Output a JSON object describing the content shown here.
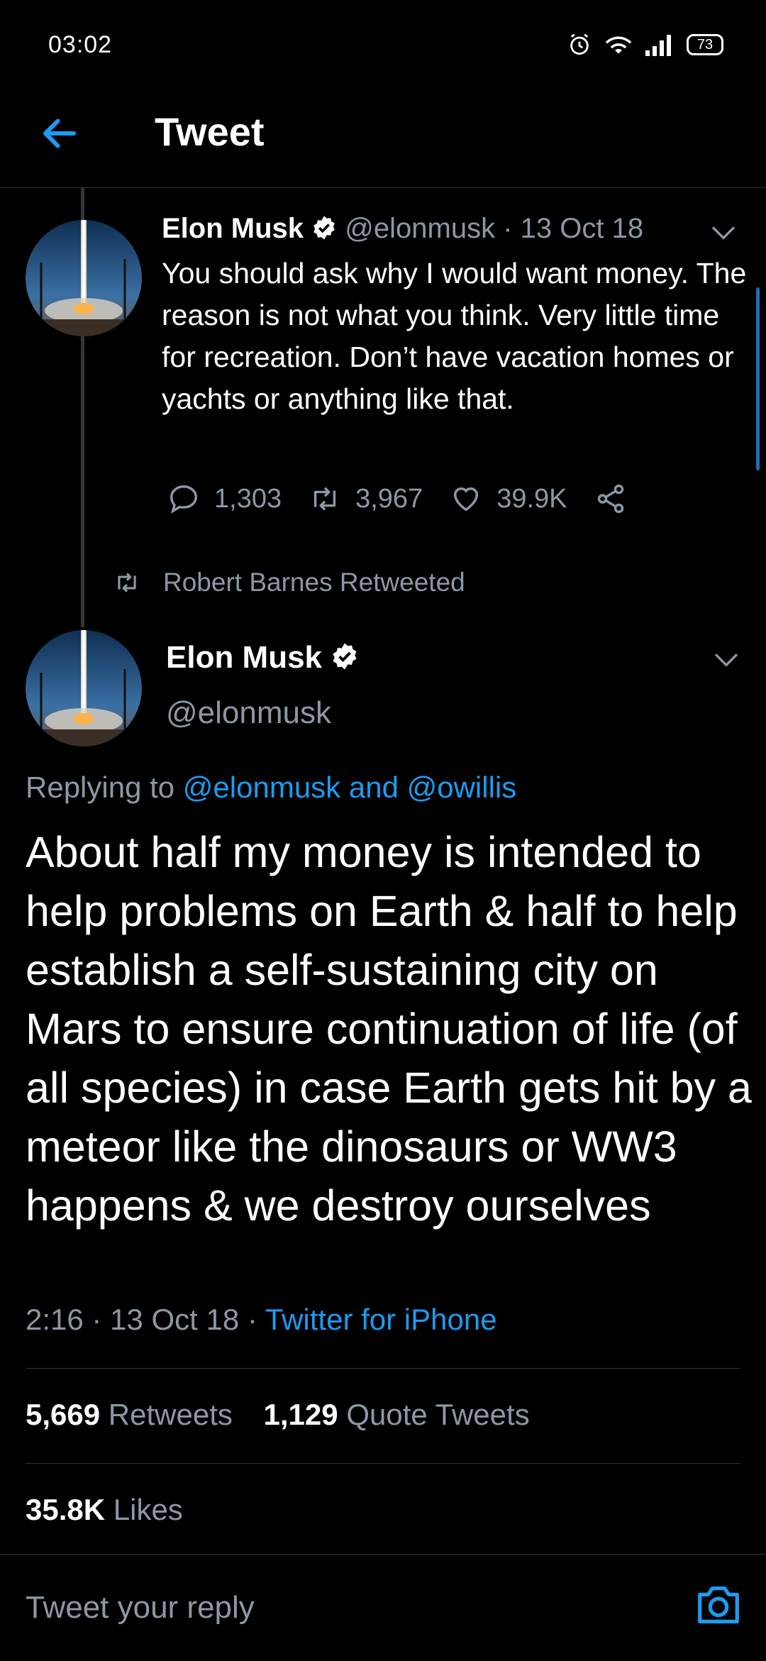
{
  "status_bar": {
    "time": "03:02",
    "battery": "73"
  },
  "header": {
    "title": "Tweet"
  },
  "parent_tweet": {
    "name": "Elon Musk",
    "handle": "@elonmusk",
    "date": "13 Oct 18",
    "text": "You should ask why I would want money. The reason is not what you think. Very little time for recreation. Don’t have vacation homes or yachts or anything like that.",
    "replies": "1,303",
    "retweets": "3,967",
    "likes": "39.9K"
  },
  "retweet_context": "Robert Barnes Retweeted",
  "main_tweet": {
    "name": "Elon Musk",
    "handle": "@elonmusk",
    "replying_prefix": "Replying to",
    "replying_users": "@elonmusk and @owillis",
    "text": "About half my money is intended to help problems on Earth & half to help establish a self-sustaining city on Mars to ensure continuation of life (of all species) in case Earth gets hit by a meteor like the dinosaurs or WW3 happens & we destroy ourselves",
    "time": "2:16",
    "date": "13 Oct 18",
    "source": "Twitter for iPhone",
    "retweets_count": "5,669",
    "retweets_label": "Retweets",
    "quotes_count": "1,129",
    "quotes_label": "Quote Tweets",
    "likes_count": "35.8K",
    "likes_label": "Likes"
  },
  "reply_box": {
    "placeholder": "Tweet your reply"
  },
  "colors": {
    "accent": "#1d9bf0",
    "muted": "#8b98a5",
    "background": "#000000"
  }
}
